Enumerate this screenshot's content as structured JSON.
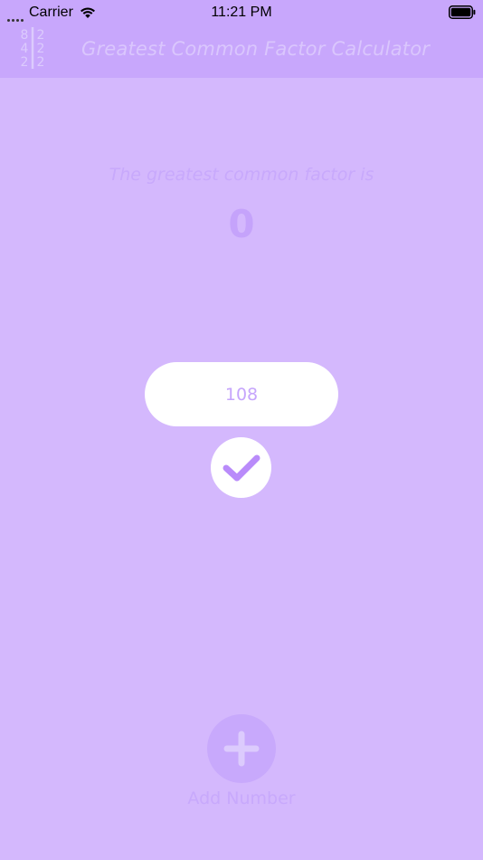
{
  "status_bar": {
    "carrier": "Carrier",
    "time": "11:21 PM",
    "signal_icon": "signal-dots-icon",
    "wifi_icon": "wifi-icon",
    "battery_icon": "battery-icon"
  },
  "nav": {
    "title": "Greatest Common Factor Calculator",
    "logo_icon": "factor-tree-logo-icon",
    "logo_digits": [
      "8",
      "2",
      "4",
      "2",
      "2",
      "2"
    ]
  },
  "result": {
    "label": "The greatest common factor is",
    "value": "0"
  },
  "input": {
    "value": "108",
    "placeholder": ""
  },
  "confirm_button": {
    "icon": "checkmark-icon"
  },
  "add_number": {
    "icon": "plus-icon",
    "label": "Add Number"
  },
  "colors": {
    "background": "#d4b8fd",
    "bar": "#c8a7fc",
    "accent": "#b98bfa",
    "white": "#ffffff"
  }
}
